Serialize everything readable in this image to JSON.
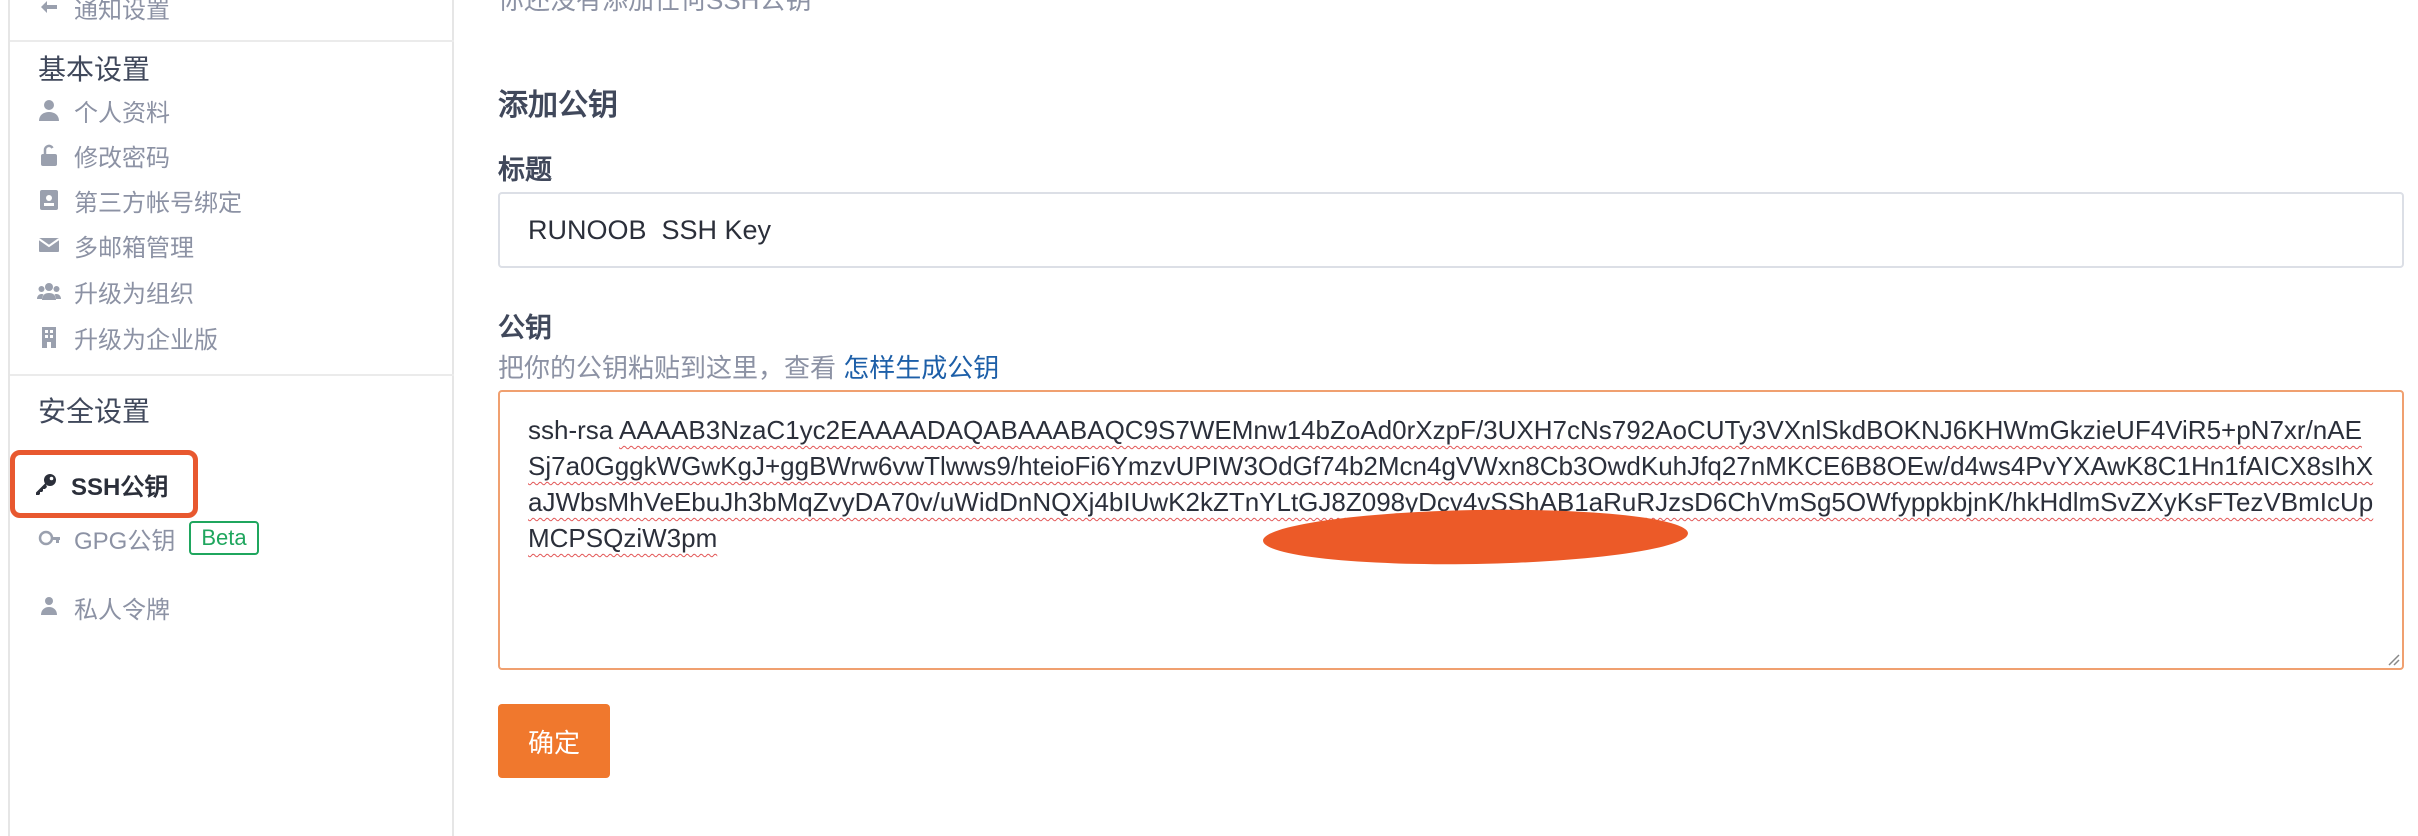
{
  "sidebar": {
    "top_item": "通知设置",
    "basic_section": "基本设置",
    "basic_items": [
      {
        "label": "个人资料",
        "icon": "user-icon"
      },
      {
        "label": "修改密码",
        "icon": "unlock-icon"
      },
      {
        "label": "第三方帐号绑定",
        "icon": "id-card-icon"
      },
      {
        "label": "多邮箱管理",
        "icon": "envelope-icon"
      },
      {
        "label": "升级为组织",
        "icon": "users-icon"
      },
      {
        "label": "升级为企业版",
        "icon": "building-icon"
      }
    ],
    "security_section": "安全设置",
    "security_items": [
      {
        "label": "SSH公钥",
        "icon": "key-icon",
        "active": true
      },
      {
        "label": "GPG公钥",
        "icon": "gpg-key-icon",
        "badge": "Beta"
      },
      {
        "label": "私人令牌",
        "icon": "token-icon"
      }
    ]
  },
  "main": {
    "top_note": "你还没有添加任何SSH公钥",
    "section_title": "添加公钥",
    "title_label": "标题",
    "title_value": "RUNOOB  SSH Key",
    "key_label": "公钥",
    "key_hint": "把你的公钥粘贴到这里，查看",
    "key_hint_link": "怎样生成公钥",
    "key_prefix": "ssh-rsa ",
    "key_body": "AAAAB3NzaC1yc2EAAAADAQABAAABAQC9S7WEMnw14bZoAd0rXzpF/3UXH7cNs792AoCUTy3VXnlSkdBOKNJ6KHWmGkzieUF4ViR5+pN7xr/nAESj7a0GggkWGwKgJ+ggBWrw6vwTlwws9/hteioFi6YmzvUPIW3OdGf74b2Mcn4gVWxn8Cb3OwdKuhJfq27nMKCE6B8OEw/d4ws4PvYXAwK8C1Hn1fAICX8sIhXaJWbsMhVeEbuJh3bMqZvyDA70v/uWidDnNQXj4bIUwK2kZTnYLtGJ8Z098yDcy4vSShAB1aRuRJzsD6ChVmSg5OWfyppkbjnK/hkHdlmSvZXyKsFTezVBmIcUpMCPSQziW3pm",
    "submit_label": "确定",
    "accent_color": "#f0782d"
  }
}
